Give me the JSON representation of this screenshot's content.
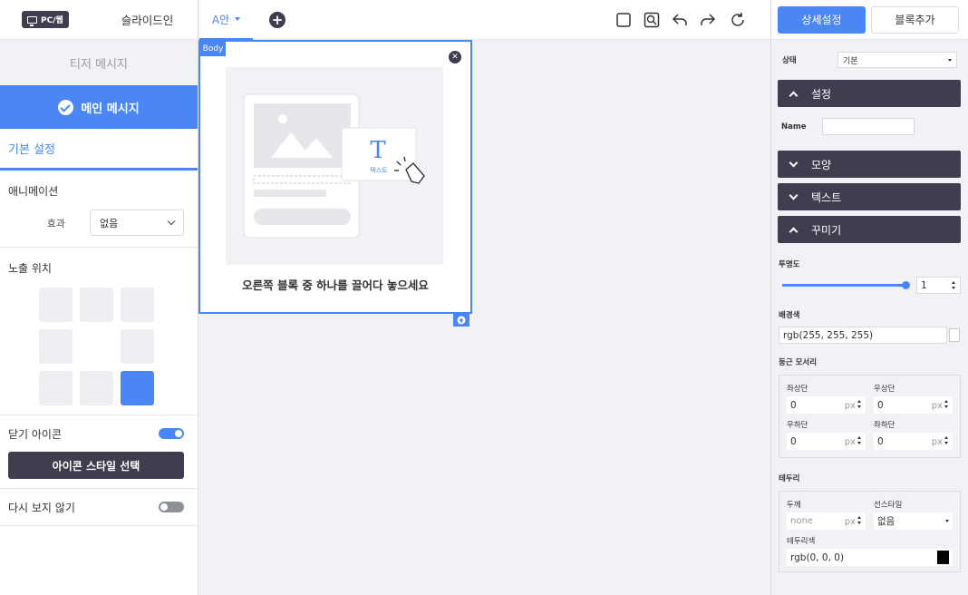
{
  "left": {
    "device_badge": "PC/웹",
    "slide_in_label": "슬라이드인",
    "teaser_label": "티저 메시지",
    "main_message_label": "메인 메시지",
    "basic_settings_tab": "기본 설정",
    "animation": {
      "title": "애니메이션",
      "effect_label": "효과",
      "effect_value": "없음"
    },
    "position": {
      "title": "노출 위치",
      "cells": [
        "filled",
        "filled",
        "filled",
        "filled",
        "empty",
        "filled",
        "filled",
        "filled",
        "selected"
      ]
    },
    "close_icon": {
      "label": "닫기 아이콘",
      "on": true
    },
    "icon_style_button": "아이콘 스타일 선택",
    "dont_show_again": {
      "label": "다시 보지 않기",
      "on": false
    }
  },
  "topbar": {
    "variant_tab": "A안",
    "icons": [
      "square-icon",
      "zoom-icon",
      "undo-icon",
      "redo-icon",
      "refresh-icon"
    ]
  },
  "canvas": {
    "body_tag": "Body",
    "illustration_text_label": "텍스트",
    "drop_hint": "오른쪽 블록 중 하나를 끌어다 놓으세요"
  },
  "right": {
    "tabs": [
      "상세설정",
      "블록추가"
    ],
    "state_label": "상태",
    "state_value": "기본",
    "sections": {
      "settings": "설정",
      "shape": "모양",
      "text": "텍스트",
      "decoration": "꾸미기"
    },
    "name_label": "Name",
    "name_value": "",
    "opacity": {
      "label": "투명도",
      "value": "1",
      "fraction": 1
    },
    "background": {
      "label": "배경색",
      "value": "rgb(255, 255, 255)",
      "swatch": "#ffffff"
    },
    "radius": {
      "title": "둥근 모서리",
      "top_left_label": "좌상단",
      "top_left": "0",
      "top_right_label": "우상단",
      "top_right": "0",
      "bottom_right_label": "우하단",
      "bottom_right": "0",
      "bottom_left_label": "좌하단",
      "bottom_left": "0",
      "unit": "px"
    },
    "border": {
      "title": "테두리",
      "width_label": "두께",
      "width_placeholder": "none",
      "unit": "px",
      "style_label": "선스타일",
      "style_value": "없음",
      "color_label": "테두리색",
      "color_value": "rgb(0, 0, 0)",
      "color_swatch": "#000000"
    }
  },
  "colors": {
    "accent": "#4a86f5",
    "dark": "#3e3e4f"
  }
}
